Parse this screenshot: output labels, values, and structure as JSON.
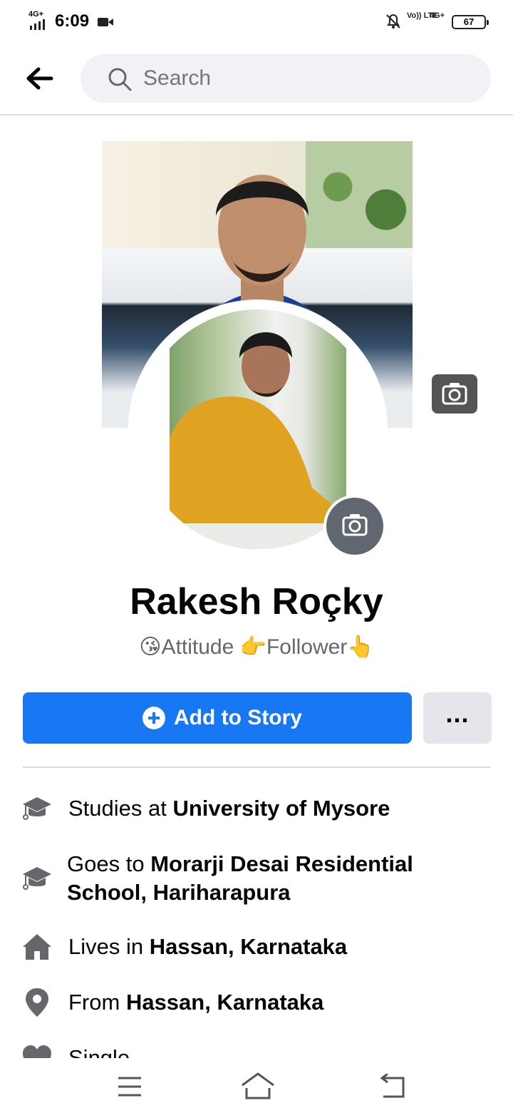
{
  "status_bar": {
    "network": "4G+",
    "time": "6:09",
    "volte": "Vo)) LTE",
    "network_right": "4G+",
    "battery": "67"
  },
  "search": {
    "placeholder": "Search"
  },
  "profile": {
    "name": "Rakesh Roçky",
    "bio": "😘Attitude 👉Follower👆"
  },
  "actions": {
    "add_story_label": "Add to Story",
    "more_label": "..."
  },
  "info": [
    {
      "icon": "graduation-cap-icon",
      "prefix": "Studies at ",
      "value": "University of Mysore"
    },
    {
      "icon": "graduation-cap-icon",
      "prefix": "Goes to ",
      "value": "Morarji Desai Residential School, Hariharapura"
    },
    {
      "icon": "home-icon",
      "prefix": "Lives in ",
      "value": "Hassan, Karnataka"
    },
    {
      "icon": "location-pin-icon",
      "prefix": "From ",
      "value": "Hassan, Karnataka"
    },
    {
      "icon": "heart-icon",
      "prefix": "Single",
      "value": ""
    }
  ],
  "colors": {
    "primary": "#1877f2",
    "secondary_button": "#e4e6eb",
    "search_bg": "#f0f2f5",
    "muted_text": "#65676b"
  }
}
